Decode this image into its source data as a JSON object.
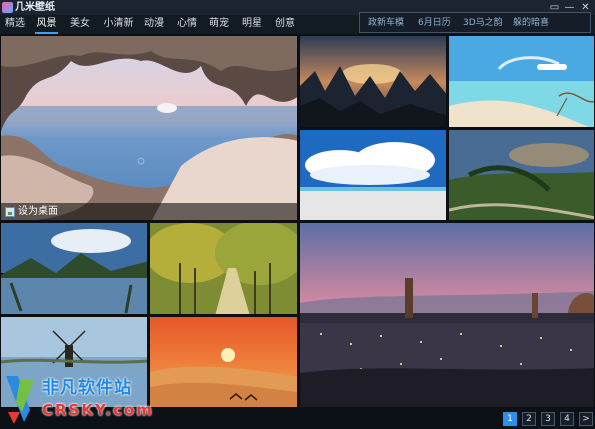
{
  "app": {
    "title": "几米壁纸",
    "window_buttons": [
      "▭",
      "—",
      "✕"
    ]
  },
  "nav": {
    "items": [
      "精选",
      "风景",
      "美女",
      "小清新",
      "动漫",
      "心情",
      "萌宠",
      "明星",
      "创意"
    ],
    "active": "风景"
  },
  "promo": {
    "items": [
      "政新车模",
      "6月日历",
      "3D马之韵",
      "躲的暗喜"
    ]
  },
  "gallery": {
    "featured_caption": "设为桌面"
  },
  "pagination": {
    "pages": [
      "1",
      "2",
      "3",
      "4"
    ],
    "next": ">",
    "current": "1"
  },
  "watermark": {
    "line1": "非凡软件站",
    "line2": "CRSKY.com"
  },
  "colors": {
    "accent": "#3aa0ff",
    "page_active": "#2f8fe8",
    "background": "#0c1117"
  }
}
